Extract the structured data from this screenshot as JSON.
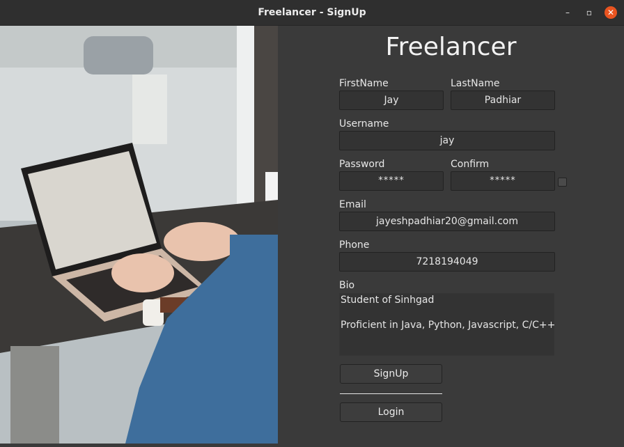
{
  "window": {
    "title": "Freelancer - SignUp",
    "minimize_glyph": "–",
    "maximize_glyph": "▫",
    "close_glyph": "✕"
  },
  "form": {
    "app_title": "Freelancer",
    "firstname": {
      "label": "FirstName",
      "value": "Jay"
    },
    "lastname": {
      "label": "LastName",
      "value": "Padhiar"
    },
    "username": {
      "label": "Username",
      "value": "jay"
    },
    "password": {
      "label": "Password",
      "value": "*****"
    },
    "confirm": {
      "label": "Confirm",
      "value": "*****"
    },
    "email": {
      "label": "Email",
      "value": "jayeshpadhiar20@gmail.com"
    },
    "phone": {
      "label": "Phone",
      "value": "7218194049"
    },
    "bio": {
      "label": "Bio",
      "lines": [
        "Student of Sinhgad",
        "",
        "Proficient in Java, Python, Javascript, C/C++"
      ]
    },
    "signup_label": "SignUp",
    "login_label": "Login"
  },
  "colors": {
    "accent_close": "#e95420",
    "panel_bg": "#3a3a3a",
    "field_bg": "#333333"
  }
}
